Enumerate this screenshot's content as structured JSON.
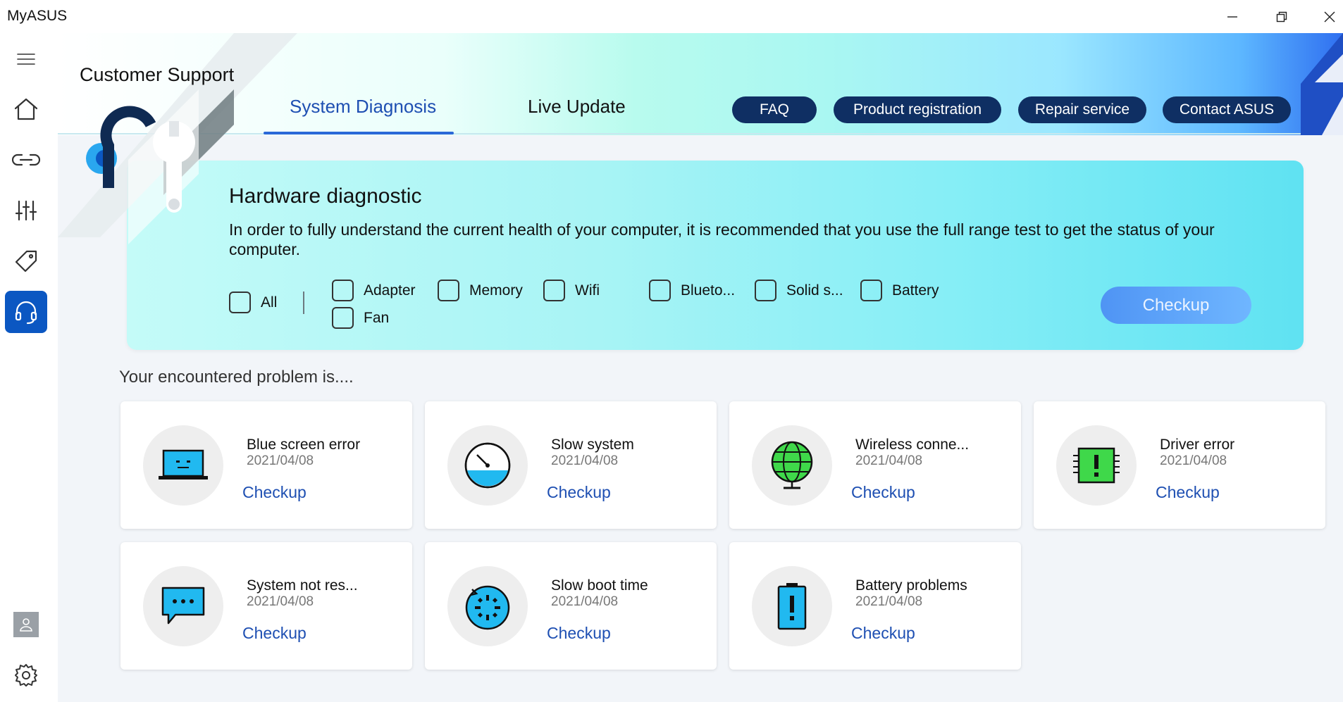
{
  "window": {
    "title": "MyASUS"
  },
  "header": {
    "page_title": "Customer Support",
    "tabs": [
      {
        "label": "System Diagnosis",
        "active": true
      },
      {
        "label": "Live Update",
        "active": false
      }
    ],
    "pills": [
      "FAQ",
      "Product registration",
      "Repair service",
      "Contact ASUS"
    ]
  },
  "sidebar": {
    "items": [
      "menu-icon",
      "home-icon",
      "link-icon",
      "sliders-icon",
      "tag-icon",
      "headset-icon"
    ],
    "active": "headset-icon",
    "bottom": [
      "avatar-icon",
      "gear-icon"
    ]
  },
  "diagnostic": {
    "title": "Hardware diagnostic",
    "description": "In order to fully understand the current health of your computer, it is recommended that you use the full range test to get the status of your computer.",
    "options": {
      "all": "All",
      "adapter": "Adapter",
      "memory": "Memory",
      "wifi": "Wifi",
      "bluetooth": "Blueto...",
      "ssd": "Solid s...",
      "battery": "Battery",
      "fan": "Fan"
    },
    "button": "Checkup"
  },
  "problems": {
    "label": "Your encountered problem is....",
    "items": [
      {
        "title": "Blue screen error",
        "date": "2021/04/08",
        "link": "Checkup"
      },
      {
        "title": "Slow system",
        "date": "2021/04/08",
        "link": "Checkup"
      },
      {
        "title": "Wireless conne...",
        "date": "2021/04/08",
        "link": "Checkup"
      },
      {
        "title": "Driver error",
        "date": "2021/04/08",
        "link": "Checkup"
      },
      {
        "title": "System not res...",
        "date": "2021/04/08",
        "link": "Checkup"
      },
      {
        "title": "Slow boot time",
        "date": "2021/04/08",
        "link": "Checkup"
      },
      {
        "title": "Battery problems",
        "date": "2021/04/08",
        "link": "Checkup"
      }
    ]
  },
  "colors": {
    "accent": "#0b57c2",
    "pill": "#0f2f63",
    "link": "#1e4fb2",
    "icon_blue": "#21b9f0",
    "icon_green": "#3fd84a"
  }
}
